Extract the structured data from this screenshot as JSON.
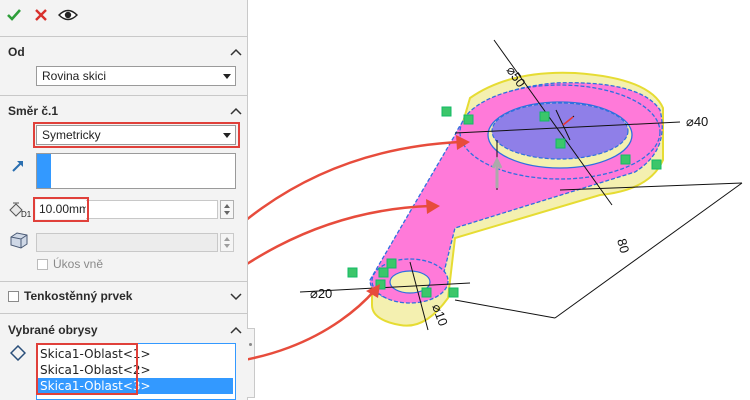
{
  "toolbar": {
    "ok_icon": "check-icon",
    "cancel_icon": "x-icon",
    "preview_icon": "eye-icon"
  },
  "from": {
    "title": "Od",
    "value": "Rovina skici"
  },
  "direction1": {
    "title": "Směr č.1",
    "end_condition": "Symetricky",
    "depth_symbol": "D1",
    "depth_value": "10.00mm",
    "draft_outward_label": "Úkos vně"
  },
  "thin_feature": {
    "label": "Tenkostěnný prvek"
  },
  "selected_contours": {
    "title": "Vybrané obrysy",
    "items": [
      "Skica1-Oblast<1>",
      "Skica1-Oblast<2>",
      "Skica1-Oblast<3>"
    ],
    "selected_index": 2
  },
  "model": {
    "dims": [
      "⌀50",
      "⌀40",
      "⌀20",
      "⌀10",
      "80"
    ],
    "colors": {
      "body": "#f4f0b0",
      "region": "#ff7ad9",
      "hole": "#8f7fe8",
      "annotation": "#e74c3c"
    }
  }
}
